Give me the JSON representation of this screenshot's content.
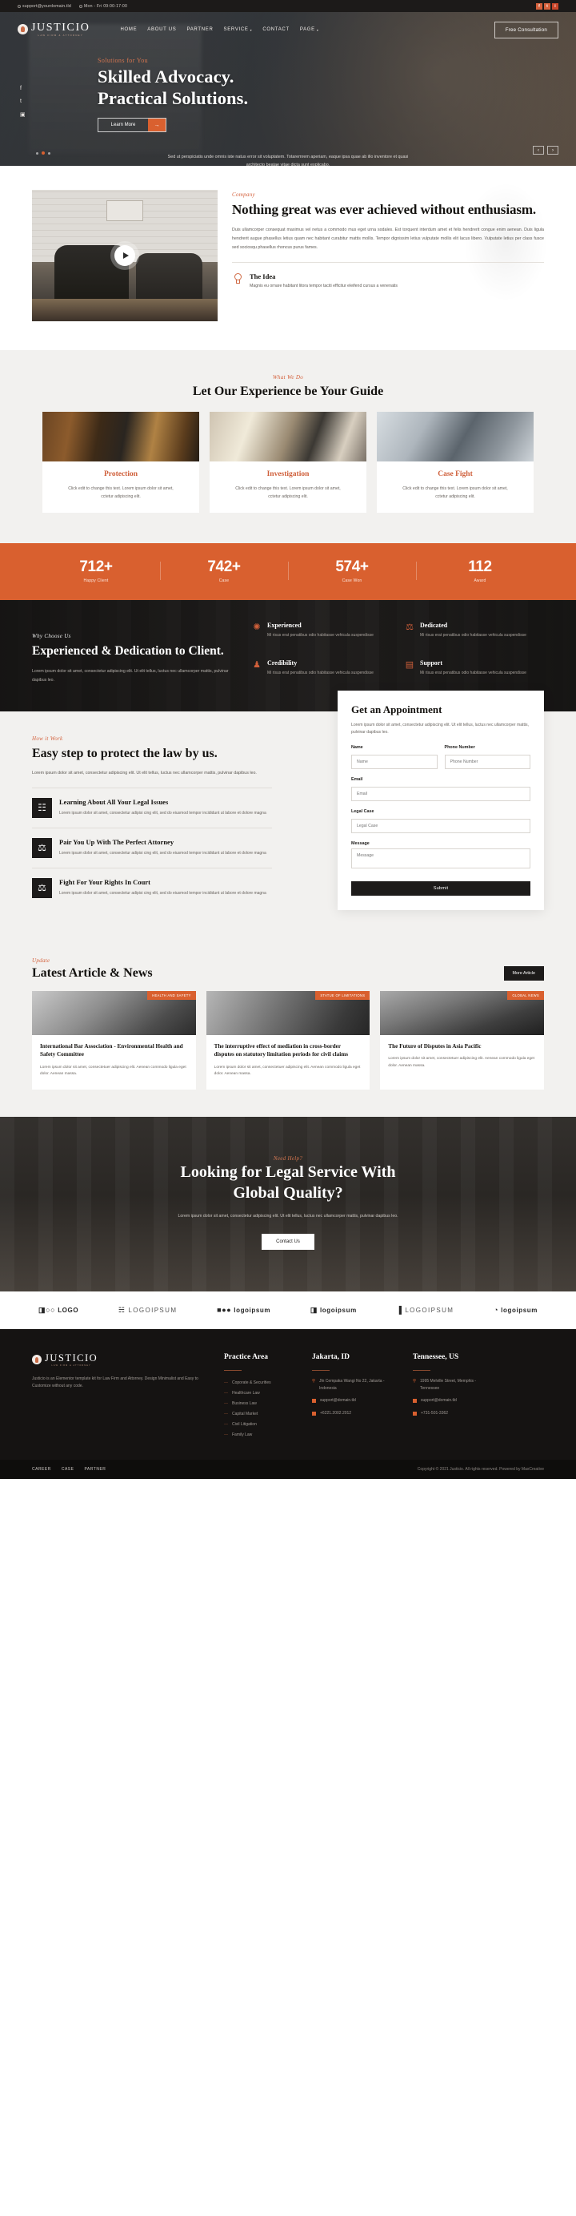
{
  "topbar": {
    "email": "support@yourdomain.tld",
    "hours": "Mon - Fri 09:00-17:00",
    "social": [
      "f",
      "t",
      "i"
    ]
  },
  "nav": {
    "brand": "JUSTICIO",
    "brand_sub": "LAW FIRM & ATTORNEY",
    "items": [
      {
        "label": "HOME",
        "caret": ""
      },
      {
        "label": "ABOUT US",
        "caret": ""
      },
      {
        "label": "PARTNER",
        "caret": ""
      },
      {
        "label": "SERVICE",
        "caret": "▾"
      },
      {
        "label": "CONTACT",
        "caret": ""
      },
      {
        "label": "PAGE",
        "caret": "▾"
      }
    ],
    "cta": "Free Consultation"
  },
  "hero": {
    "eyebrow": "Solutions for You",
    "title_line1": "Skilled Advocacy.",
    "title_line2": "Practical Solutions.",
    "button": "Learn More",
    "button_arrow": "→",
    "description": "Sed ut perspiciatis unde omnis iste natus error sit voluptatem. Totaremrem aperiam, eaque ipsa quae ab illo inventore et quasi architecto beatae vitae dicta sunt explicabo.",
    "social": [
      "f",
      "t",
      "▣"
    ],
    "prev": "‹",
    "next": "›"
  },
  "about": {
    "eyebrow": "Company",
    "title": "Nothing great was ever achieved without enthusiasm.",
    "paragraph": "Duis ullamcorper consequat maximus vel netus a commodo mus eget urna sodales. Est torquent interdum amet et felis hendrerit congue enim aenean. Duis ligula hendrerit augue phasellus letius quam nec habitant curabitur mattis mollis. Tempor dignissim letius vulputate mollis elit lacus libero. Vulputate letius per class fusce sed sociosqu phasellus rhoncus purus fames.",
    "idea_title": "The Idea",
    "idea_text": "Magnis eu ornare habitant litora tempor taciti efficitur eleifend cursus a venenatis",
    "play": "play-button"
  },
  "services": {
    "eyebrow": "What We Do",
    "title": "Let Our Experience be Your Guide",
    "cards": [
      {
        "title": "Protection",
        "text": "Click edit to change this text. Lorem ipsum dolor sit amet, cctetur adipiscing elit."
      },
      {
        "title": "Investigation",
        "text": "Click edit to change this text. Lorem ipsum dolor sit amet, cctetur adipiscing elit."
      },
      {
        "title": "Case Fight",
        "text": "Click edit to change this text. Lorem ipsum dolor sit amet, cctetur adipiscing elit."
      }
    ]
  },
  "counters": [
    {
      "num": "712+",
      "label": "Happy Client"
    },
    {
      "num": "742+",
      "label": "Case"
    },
    {
      "num": "574+",
      "label": "Case Won"
    },
    {
      "num": "112",
      "label": "Award"
    }
  ],
  "why": {
    "eyebrow": "Why Choose Us",
    "title": "Experienced & Dedication to Client.",
    "paragraph": "Lorem ipsum dolor sit amet, consectetur adipiscing elit. Ut elit tellus, luctus nec ullamcorper mattis, pulvinar dapibus leo.",
    "features": [
      {
        "icon": "✺",
        "title": "Experienced",
        "text": "Mi risus erat penatibus odio habitasse vehicula suspendisse"
      },
      {
        "icon": "⚖",
        "title": "Dedicated",
        "text": "Mi risus erat penatibus odio habitasse vehicula suspendisse"
      },
      {
        "icon": "♟",
        "title": "Credibility",
        "text": "Mi risus erat penatibus odio habitasse vehicula suspendisse"
      },
      {
        "icon": "▤",
        "title": "Support",
        "text": "Mi risus erat penatibus odio habitasse vehicula suspendisse"
      }
    ]
  },
  "how": {
    "eyebrow": "How it Work",
    "title": "Easy step to protect the law by us.",
    "paragraph": "Lorem ipsum dolor sit amet, consectetur adipiscing elit. Ut elit tellus, luctus nec ullamcorper mattis, pulvinar dapibus leo.",
    "steps": [
      {
        "icon": "☷",
        "title": "Learning About All Your Legal Issues",
        "text": "Lorem ipsum dolor sit amet, consectetur adipisi cing elit, sed do eiusmod tempor incididunt ut labore et dolore magna"
      },
      {
        "icon": "⚖",
        "title": "Pair You Up With The Perfect Attorney",
        "text": "Lorem ipsum dolor sit amet, consectetur adipisi cing elit, sed do eiusmod tempor incididunt ut labore et dolore magna"
      },
      {
        "icon": "⚖",
        "title": "Fight For Your Rights In Court",
        "text": "Lorem ipsum dolor sit amet, consectetur adipisi cing elit, sed do eiusmod tempor incididunt ut labore et dolore magna"
      }
    ]
  },
  "form": {
    "title": "Get an Appointment",
    "paragraph": "Lorem ipsum dolor sit amet, consectetur adipiscing elit. Ut elit tellus, luctus nec ullamcorper mattis, pulvinar dapibus leo.",
    "name_label": "Name",
    "name_placeholder": "Name",
    "phone_label": "Phone Number",
    "phone_placeholder": "Phone Number",
    "email_label": "Email",
    "email_placeholder": "Email",
    "case_label": "Legal Case",
    "case_placeholder": "Legal Case",
    "message_label": "Message",
    "message_placeholder": "Message",
    "submit": "Submit"
  },
  "blog": {
    "eyebrow": "Update",
    "title": "Latest Article & News",
    "more": "More Article",
    "posts": [
      {
        "tag": "HEALTH AND SAFETY",
        "title": "International Bar Association - Environmental Health and Safety Committee",
        "text": "Lorem ipsum dolor sit amet, consectetuer adipiscing elit. Aenean commodo ligula eget dolor. Aenean massa."
      },
      {
        "tag": "STATUE OF LIMITATIONS",
        "title": "The interruptive effect of mediation in cross-border disputes on statutory limitation periods for civil claims",
        "text": "Lorem ipsum dolor sit amet, consectetuer adipiscing elit. Aenean commodo ligula eget dolor. Aenean massa."
      },
      {
        "tag": "GLOBAL NEWS",
        "title": "The Future of Disputes in Asia Pacific",
        "text": "Lorem ipsum dolor sit amet, consectetuer adipiscing elit. Aenean commodo ligula eget dolor. Aenean massa."
      }
    ]
  },
  "cta": {
    "eyebrow": "Need Help?",
    "title_line1": "Looking for Legal Service With",
    "title_line2": "Global Quality?",
    "paragraph": "Lorem ipsum dolor sit amet, consectetur adipiscing elit. Ut elit tellus, luctus nec ullamcorper mattis, pulvinar dapibus leo.",
    "button": "Contact Us"
  },
  "logos": [
    {
      "mark": "◨○○",
      "text": "LOGO"
    },
    {
      "mark": "☵",
      "text": "LOGOIPSUM"
    },
    {
      "mark": "■●●",
      "text": "logoipsum"
    },
    {
      "mark": "◨",
      "text": "logoipsum"
    },
    {
      "mark": "▐",
      "text": "LOGOIPSUM"
    },
    {
      "mark": "◔",
      "text": "logoipsum"
    }
  ],
  "footer": {
    "brand": "JUSTICIO",
    "brand_sub": "LAW FIRM & ATTORNEY",
    "description": "Justicio is an Elementor template kit for Law Firm and Attorney. Design Minimalist and Easy to Customize without any code.",
    "practice_title": "Practice Area",
    "practice_items": [
      "Coporate & Securities",
      "Healthcare Law",
      "Business Law",
      "Capital Market",
      "Civil Litigation",
      "Family Law"
    ],
    "office1_title": "Jakarta, ID",
    "office1_address": "Jln Cempaka Wangi No 22, Jakarta - Indonesia",
    "office1_email": "support@domain.tld",
    "office1_phone": "+6221.2002.2012",
    "office2_title": "Tennessee, US",
    "office2_address": "1995 Melville Street, Memphis - Tennessee",
    "office2_email": "support@domain.tld",
    "office2_phone": "+731-501-3362"
  },
  "footbar": {
    "links": [
      "CAREER",
      "CASE",
      "PARTNER"
    ],
    "copyright": "Copyright © 2021 Justicio. All rights reserved. Powered by MaxCreative"
  },
  "colors": {
    "accent": "#d9602f",
    "dark": "#1d1b1a",
    "light_bg": "#f2f1ef"
  }
}
